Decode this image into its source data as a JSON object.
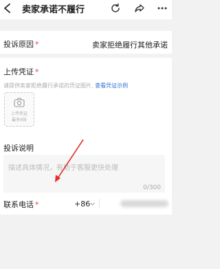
{
  "header": {
    "title": "卖家承诺不履行",
    "icons": [
      "back-icon",
      "refresh-icon",
      "share-icon",
      "more-icon"
    ]
  },
  "reason": {
    "label": "投诉原因",
    "required_mark": "*",
    "value": "卖家拒绝履行其他承诺"
  },
  "upload": {
    "label": "上传凭证",
    "required_mark": "*",
    "hint": "请提供卖家拒绝履行承诺的凭证图片, ",
    "hint_link": "查看凭证示例",
    "box_line1": "上传凭证",
    "box_line2": "最多9张"
  },
  "description": {
    "label": "投诉说明",
    "placeholder": "描述具体情况，有助于客服更快处理",
    "counter": "0/300"
  },
  "phone": {
    "label": "联系电话",
    "required_mark": "*",
    "country_code": "+86"
  },
  "colors": {
    "required": "#e64340",
    "link": "#2f6fd8",
    "annotation_arrow": "#e0302a"
  }
}
